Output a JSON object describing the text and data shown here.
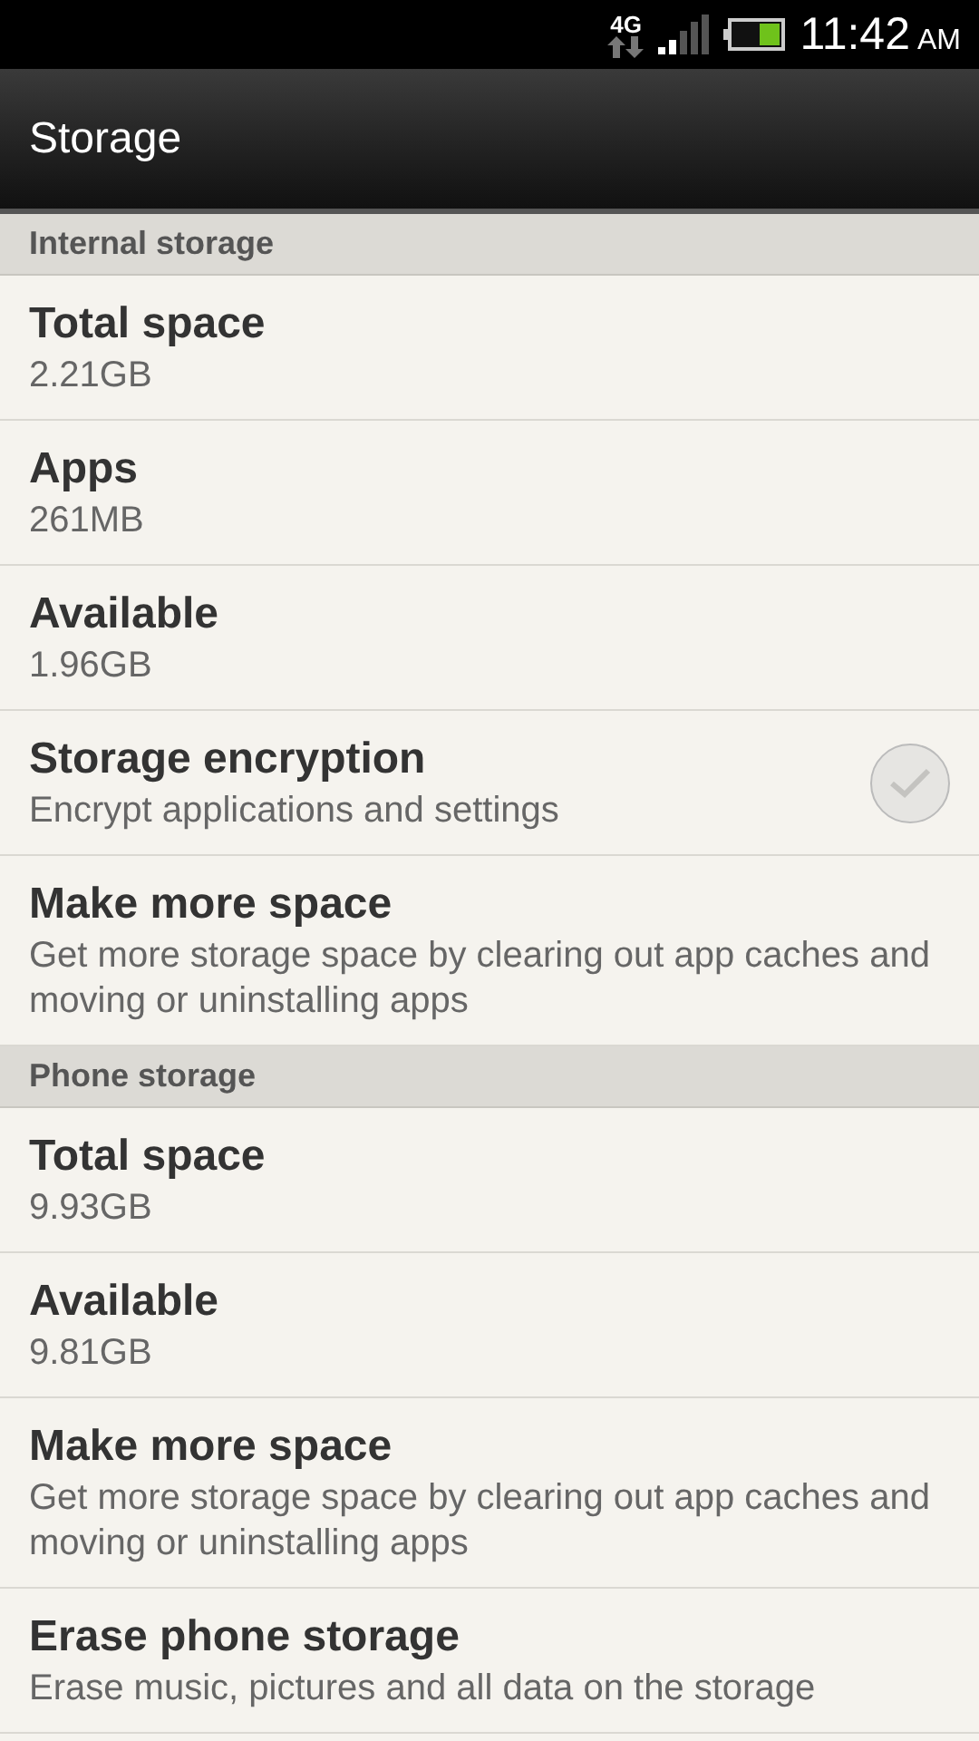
{
  "status_bar": {
    "network": "4G",
    "time": "11:42",
    "ampm": "AM"
  },
  "app_bar": {
    "title": "Storage"
  },
  "sections": [
    {
      "header": "Internal storage",
      "items": [
        {
          "kind": "info",
          "title": "Total space",
          "summary": "2.21GB"
        },
        {
          "kind": "info",
          "title": "Apps",
          "summary": "261MB"
        },
        {
          "kind": "info",
          "title": "Available",
          "summary": "1.96GB"
        },
        {
          "kind": "checkbox",
          "title": "Storage encryption",
          "summary": "Encrypt applications and settings",
          "checked": false
        },
        {
          "kind": "info",
          "title": "Make more space",
          "summary": "Get more storage space by clearing out app caches and moving or uninstalling apps"
        }
      ]
    },
    {
      "header": "Phone storage",
      "items": [
        {
          "kind": "info",
          "title": "Total space",
          "summary": "9.93GB"
        },
        {
          "kind": "info",
          "title": "Available",
          "summary": "9.81GB"
        },
        {
          "kind": "info",
          "title": "Make more space",
          "summary": "Get more storage space by clearing out app caches and moving or uninstalling apps"
        },
        {
          "kind": "info",
          "title": "Erase phone storage",
          "summary": "Erase music, pictures and all data on the storage"
        }
      ]
    }
  ]
}
